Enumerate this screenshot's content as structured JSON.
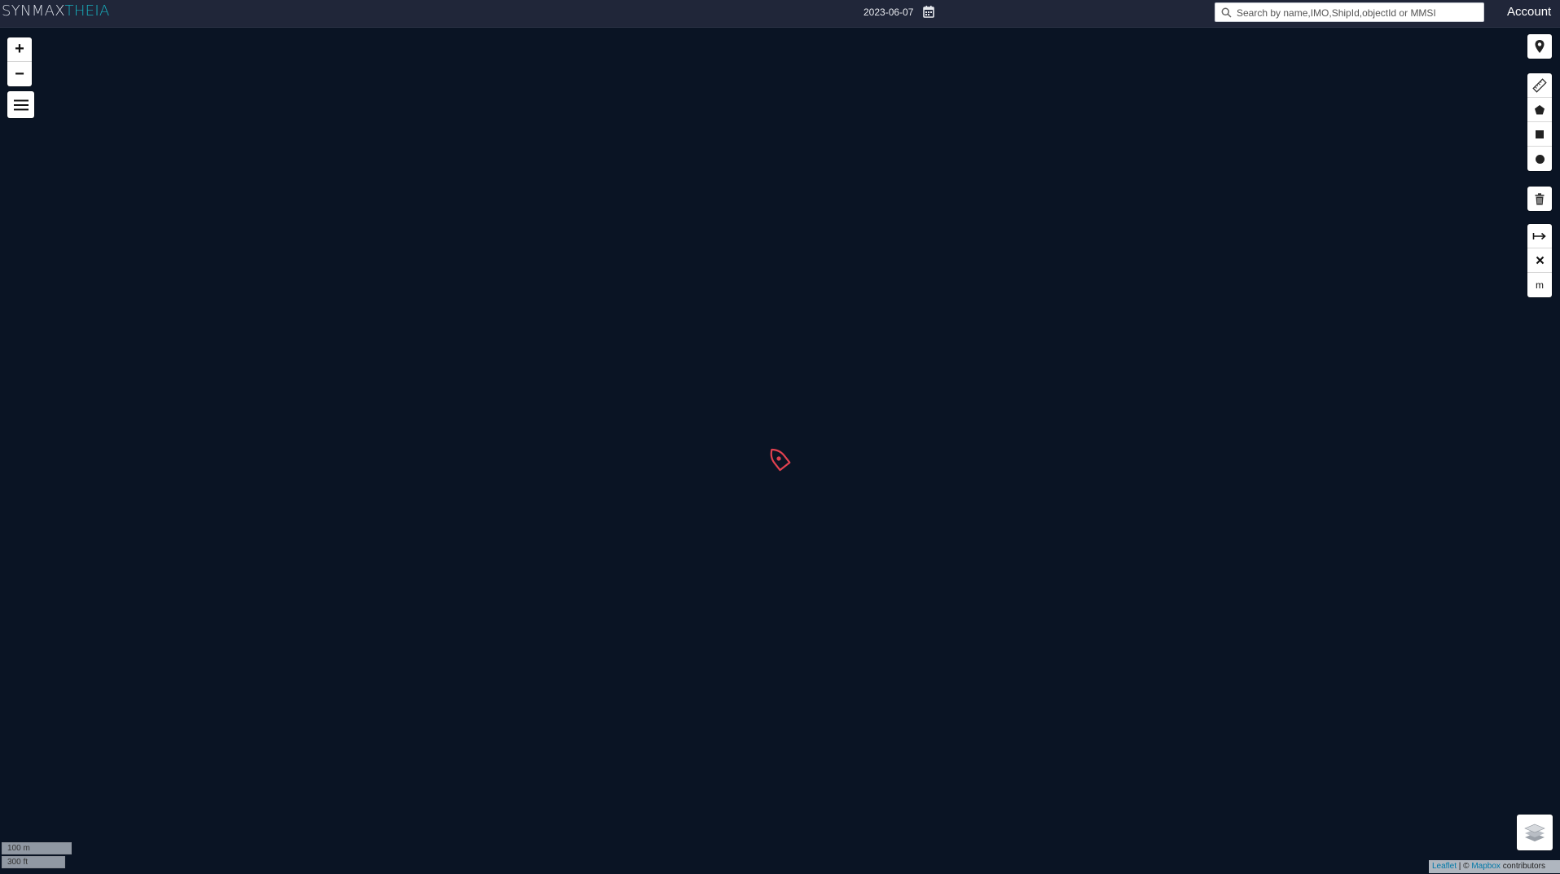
{
  "header": {
    "logo_part1": "SYNMAX",
    "logo_part2": "THEIA",
    "date": "2023-06-07",
    "search_placeholder": "Search by name,IMO,ShipId,objectId or MMSI",
    "account_label": "Account"
  },
  "map_controls": {
    "zoom_in": "+",
    "zoom_out": "−",
    "measure_unit_label": "m"
  },
  "scale": {
    "metric": "100 m",
    "imperial": "300 ft"
  },
  "attribution": {
    "leaflet": "Leaflet",
    "separator": " | © ",
    "mapbox": "Mapbox",
    "contributors": " contributors"
  },
  "colors": {
    "accent": "#17b2c0",
    "vessel": "#e0414f",
    "map_background": "#0a1424",
    "header_background": "#202639"
  },
  "icons": [
    "calendar-icon",
    "search-icon",
    "hamburger-icon",
    "map-pin-icon",
    "ruler-icon",
    "polygon-icon",
    "rectangle-icon",
    "circle-icon",
    "trash-icon",
    "measure-arrow-icon",
    "close-icon",
    "layers-icon",
    "vessel-icon"
  ]
}
